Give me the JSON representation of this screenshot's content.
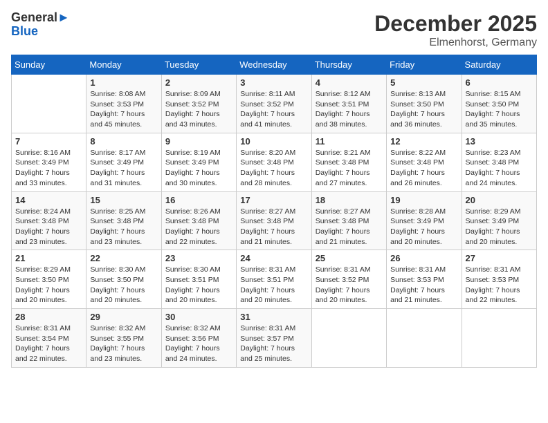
{
  "header": {
    "logo_general": "General",
    "logo_blue": "Blue",
    "month_title": "December 2025",
    "location": "Elmenhorst, Germany"
  },
  "days_of_week": [
    "Sunday",
    "Monday",
    "Tuesday",
    "Wednesday",
    "Thursday",
    "Friday",
    "Saturday"
  ],
  "weeks": [
    [
      {
        "day": "",
        "sunrise": "",
        "sunset": "",
        "daylight": ""
      },
      {
        "day": "1",
        "sunrise": "Sunrise: 8:08 AM",
        "sunset": "Sunset: 3:53 PM",
        "daylight": "Daylight: 7 hours and 45 minutes."
      },
      {
        "day": "2",
        "sunrise": "Sunrise: 8:09 AM",
        "sunset": "Sunset: 3:52 PM",
        "daylight": "Daylight: 7 hours and 43 minutes."
      },
      {
        "day": "3",
        "sunrise": "Sunrise: 8:11 AM",
        "sunset": "Sunset: 3:52 PM",
        "daylight": "Daylight: 7 hours and 41 minutes."
      },
      {
        "day": "4",
        "sunrise": "Sunrise: 8:12 AM",
        "sunset": "Sunset: 3:51 PM",
        "daylight": "Daylight: 7 hours and 38 minutes."
      },
      {
        "day": "5",
        "sunrise": "Sunrise: 8:13 AM",
        "sunset": "Sunset: 3:50 PM",
        "daylight": "Daylight: 7 hours and 36 minutes."
      },
      {
        "day": "6",
        "sunrise": "Sunrise: 8:15 AM",
        "sunset": "Sunset: 3:50 PM",
        "daylight": "Daylight: 7 hours and 35 minutes."
      }
    ],
    [
      {
        "day": "7",
        "sunrise": "Sunrise: 8:16 AM",
        "sunset": "Sunset: 3:49 PM",
        "daylight": "Daylight: 7 hours and 33 minutes."
      },
      {
        "day": "8",
        "sunrise": "Sunrise: 8:17 AM",
        "sunset": "Sunset: 3:49 PM",
        "daylight": "Daylight: 7 hours and 31 minutes."
      },
      {
        "day": "9",
        "sunrise": "Sunrise: 8:19 AM",
        "sunset": "Sunset: 3:49 PM",
        "daylight": "Daylight: 7 hours and 30 minutes."
      },
      {
        "day": "10",
        "sunrise": "Sunrise: 8:20 AM",
        "sunset": "Sunset: 3:48 PM",
        "daylight": "Daylight: 7 hours and 28 minutes."
      },
      {
        "day": "11",
        "sunrise": "Sunrise: 8:21 AM",
        "sunset": "Sunset: 3:48 PM",
        "daylight": "Daylight: 7 hours and 27 minutes."
      },
      {
        "day": "12",
        "sunrise": "Sunrise: 8:22 AM",
        "sunset": "Sunset: 3:48 PM",
        "daylight": "Daylight: 7 hours and 26 minutes."
      },
      {
        "day": "13",
        "sunrise": "Sunrise: 8:23 AM",
        "sunset": "Sunset: 3:48 PM",
        "daylight": "Daylight: 7 hours and 24 minutes."
      }
    ],
    [
      {
        "day": "14",
        "sunrise": "Sunrise: 8:24 AM",
        "sunset": "Sunset: 3:48 PM",
        "daylight": "Daylight: 7 hours and 23 minutes."
      },
      {
        "day": "15",
        "sunrise": "Sunrise: 8:25 AM",
        "sunset": "Sunset: 3:48 PM",
        "daylight": "Daylight: 7 hours and 23 minutes."
      },
      {
        "day": "16",
        "sunrise": "Sunrise: 8:26 AM",
        "sunset": "Sunset: 3:48 PM",
        "daylight": "Daylight: 7 hours and 22 minutes."
      },
      {
        "day": "17",
        "sunrise": "Sunrise: 8:27 AM",
        "sunset": "Sunset: 3:48 PM",
        "daylight": "Daylight: 7 hours and 21 minutes."
      },
      {
        "day": "18",
        "sunrise": "Sunrise: 8:27 AM",
        "sunset": "Sunset: 3:48 PM",
        "daylight": "Daylight: 7 hours and 21 minutes."
      },
      {
        "day": "19",
        "sunrise": "Sunrise: 8:28 AM",
        "sunset": "Sunset: 3:49 PM",
        "daylight": "Daylight: 7 hours and 20 minutes."
      },
      {
        "day": "20",
        "sunrise": "Sunrise: 8:29 AM",
        "sunset": "Sunset: 3:49 PM",
        "daylight": "Daylight: 7 hours and 20 minutes."
      }
    ],
    [
      {
        "day": "21",
        "sunrise": "Sunrise: 8:29 AM",
        "sunset": "Sunset: 3:50 PM",
        "daylight": "Daylight: 7 hours and 20 minutes."
      },
      {
        "day": "22",
        "sunrise": "Sunrise: 8:30 AM",
        "sunset": "Sunset: 3:50 PM",
        "daylight": "Daylight: 7 hours and 20 minutes."
      },
      {
        "day": "23",
        "sunrise": "Sunrise: 8:30 AM",
        "sunset": "Sunset: 3:51 PM",
        "daylight": "Daylight: 7 hours and 20 minutes."
      },
      {
        "day": "24",
        "sunrise": "Sunrise: 8:31 AM",
        "sunset": "Sunset: 3:51 PM",
        "daylight": "Daylight: 7 hours and 20 minutes."
      },
      {
        "day": "25",
        "sunrise": "Sunrise: 8:31 AM",
        "sunset": "Sunset: 3:52 PM",
        "daylight": "Daylight: 7 hours and 20 minutes."
      },
      {
        "day": "26",
        "sunrise": "Sunrise: 8:31 AM",
        "sunset": "Sunset: 3:53 PM",
        "daylight": "Daylight: 7 hours and 21 minutes."
      },
      {
        "day": "27",
        "sunrise": "Sunrise: 8:31 AM",
        "sunset": "Sunset: 3:53 PM",
        "daylight": "Daylight: 7 hours and 22 minutes."
      }
    ],
    [
      {
        "day": "28",
        "sunrise": "Sunrise: 8:31 AM",
        "sunset": "Sunset: 3:54 PM",
        "daylight": "Daylight: 7 hours and 22 minutes."
      },
      {
        "day": "29",
        "sunrise": "Sunrise: 8:32 AM",
        "sunset": "Sunset: 3:55 PM",
        "daylight": "Daylight: 7 hours and 23 minutes."
      },
      {
        "day": "30",
        "sunrise": "Sunrise: 8:32 AM",
        "sunset": "Sunset: 3:56 PM",
        "daylight": "Daylight: 7 hours and 24 minutes."
      },
      {
        "day": "31",
        "sunrise": "Sunrise: 8:31 AM",
        "sunset": "Sunset: 3:57 PM",
        "daylight": "Daylight: 7 hours and 25 minutes."
      },
      {
        "day": "",
        "sunrise": "",
        "sunset": "",
        "daylight": ""
      },
      {
        "day": "",
        "sunrise": "",
        "sunset": "",
        "daylight": ""
      },
      {
        "day": "",
        "sunrise": "",
        "sunset": "",
        "daylight": ""
      }
    ]
  ]
}
